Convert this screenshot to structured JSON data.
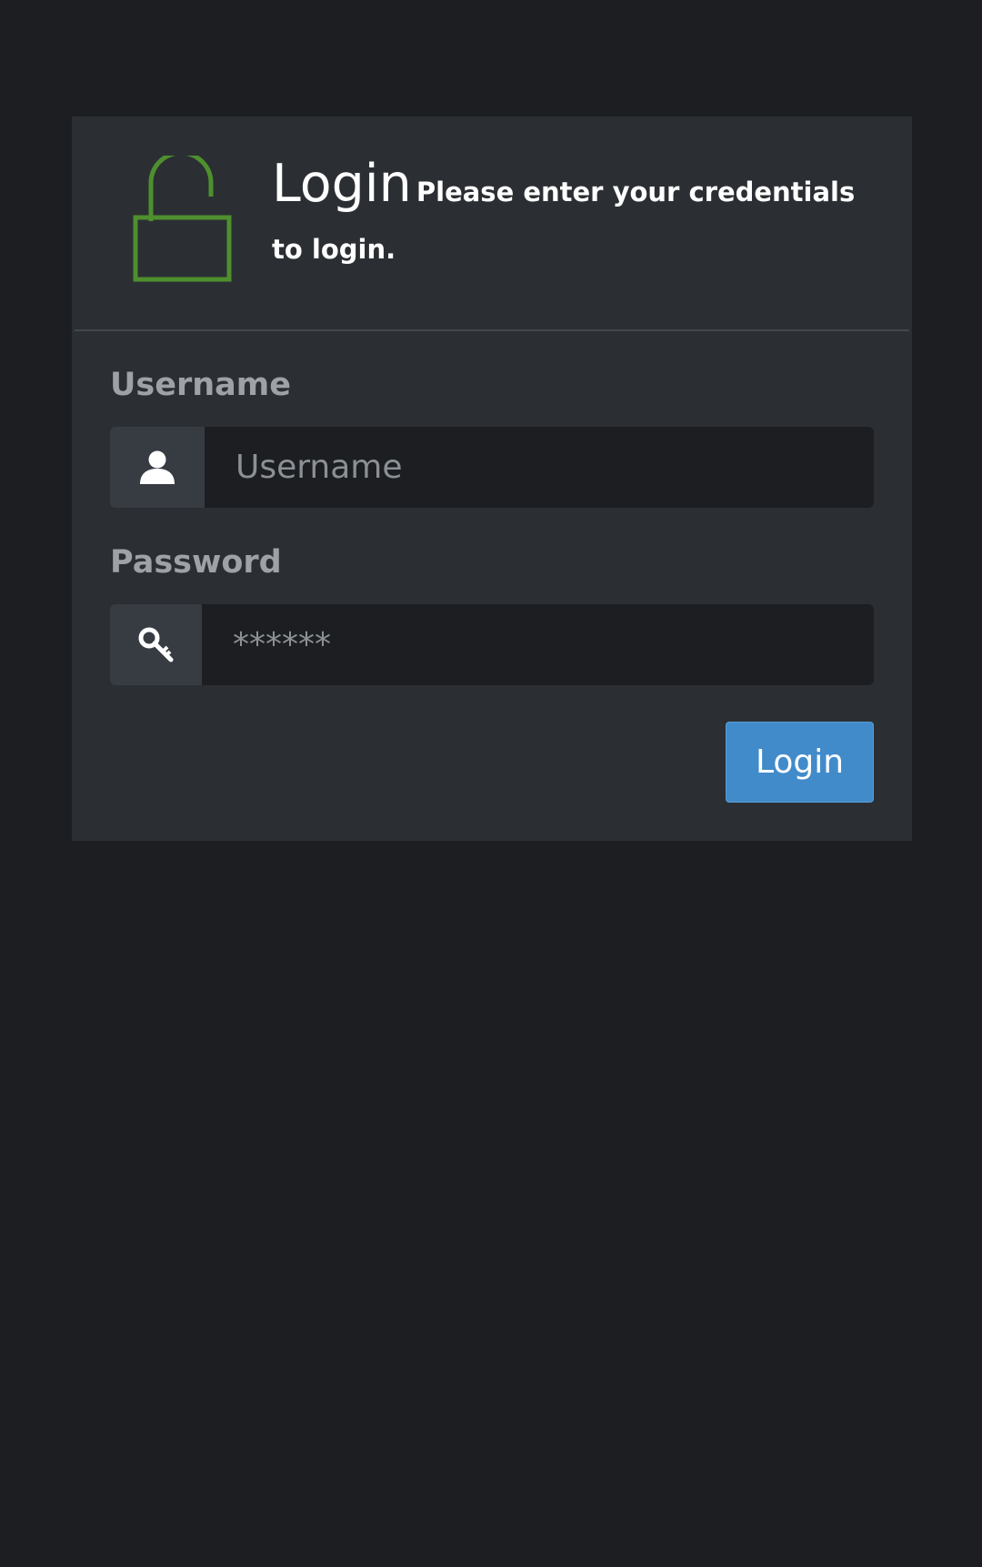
{
  "header": {
    "title": "Login",
    "subtitle": "Please enter your credentials to login.",
    "icon": "unlock-icon",
    "icon_color": "#4e8f2e"
  },
  "form": {
    "username": {
      "label": "Username",
      "placeholder": "Username",
      "value": "",
      "icon": "user-icon"
    },
    "password": {
      "label": "Password",
      "placeholder": "******",
      "value": "",
      "icon": "key-icon"
    },
    "submit_label": "Login",
    "submit_color": "#428bca"
  }
}
